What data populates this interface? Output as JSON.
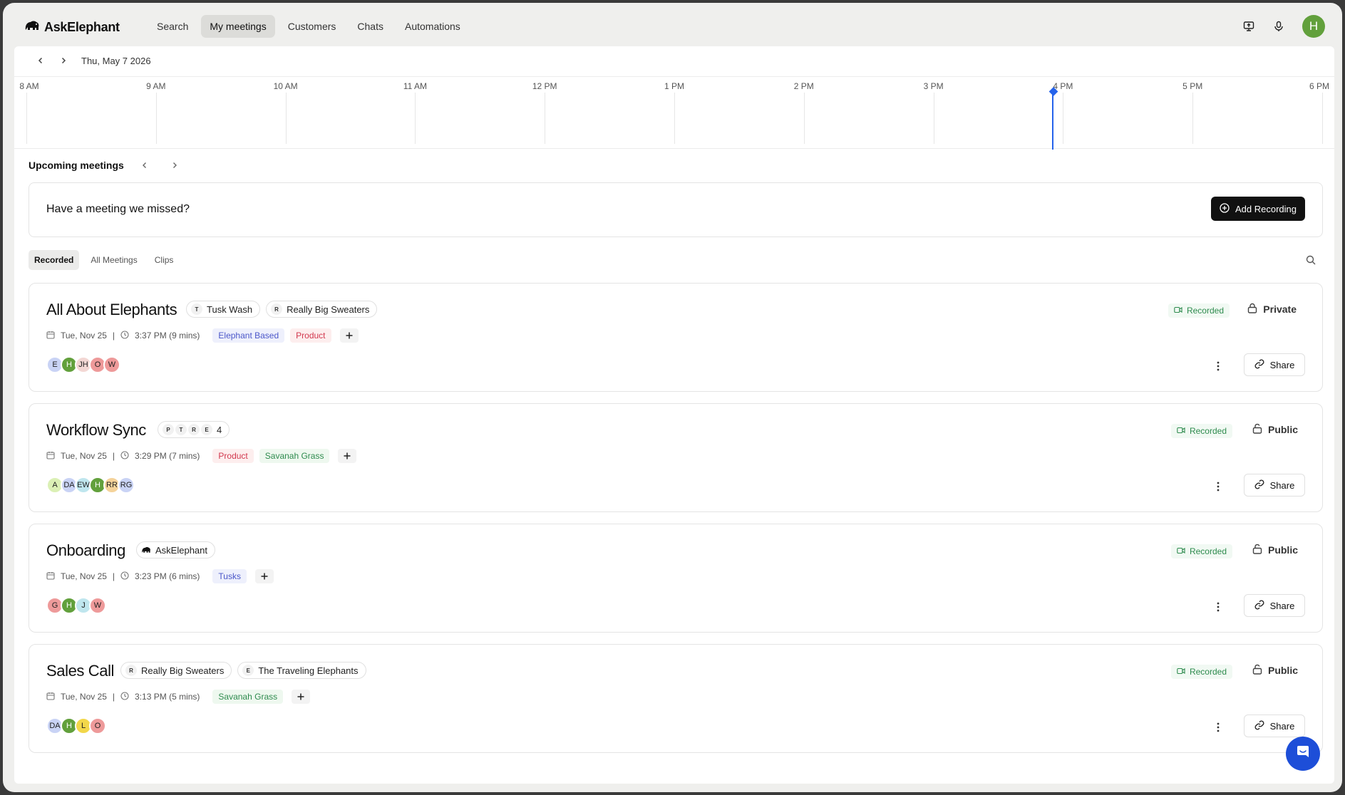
{
  "app": {
    "name": "AskElephant"
  },
  "nav": [
    {
      "label": "Search",
      "active": false
    },
    {
      "label": "My meetings",
      "active": true
    },
    {
      "label": "Customers",
      "active": false
    },
    {
      "label": "Chats",
      "active": false
    },
    {
      "label": "Automations",
      "active": false
    }
  ],
  "user": {
    "initial": "H"
  },
  "date": {
    "label": "Thu, May 7 2026"
  },
  "timeline": {
    "hours": [
      "8 AM",
      "9 AM",
      "10 AM",
      "11 AM",
      "12 PM",
      "1 PM",
      "2 PM",
      "3 PM",
      "4 PM",
      "5 PM",
      "6 PM"
    ],
    "now_fraction": 0.792
  },
  "upcoming": {
    "title": "Upcoming meetings"
  },
  "missed": {
    "text": "Have a meeting we missed?",
    "button": "Add Recording"
  },
  "tabs": [
    {
      "label": "Recorded",
      "active": true
    },
    {
      "label": "All Meetings",
      "active": false
    },
    {
      "label": "Clips",
      "active": false
    }
  ],
  "colors": {
    "accent": "#2563eb",
    "recorded": "#2e8b4e",
    "avatar_green": "#62a03c"
  },
  "meetings": [
    {
      "title": "All About Elephants",
      "companies": [
        {
          "badge": "T",
          "name": "Tusk Wash"
        },
        {
          "badge": "R",
          "name": "Really Big Sweaters"
        }
      ],
      "date": "Tue, Nov 25",
      "time": "3:37 PM (9 mins)",
      "tags": [
        {
          "label": "Elephant Based",
          "kind": "blue"
        },
        {
          "label": "Product",
          "kind": "red"
        }
      ],
      "participants": [
        {
          "initials": "E",
          "color": "#c9d3f5"
        },
        {
          "initials": "H",
          "color": "#62a03c"
        },
        {
          "initials": "JH",
          "color": "#f3d7d4"
        },
        {
          "initials": "O",
          "color": "#ee9a9a"
        },
        {
          "initials": "W",
          "color": "#ee9a9a"
        }
      ],
      "status": "Recorded",
      "privacy": "Private",
      "share": "Share"
    },
    {
      "title": "Workflow Sync",
      "company_badges": [
        "P",
        "T",
        "R",
        "E"
      ],
      "company_count": "4",
      "date": "Tue, Nov 25",
      "time": "3:29 PM (7 mins)",
      "tags": [
        {
          "label": "Product",
          "kind": "red"
        },
        {
          "label": "Savanah Grass",
          "kind": "green"
        }
      ],
      "participants": [
        {
          "initials": "A",
          "color": "#dbf0b5"
        },
        {
          "initials": "DA",
          "color": "#c9d3f5"
        },
        {
          "initials": "EW",
          "color": "#bfe6ee"
        },
        {
          "initials": "H",
          "color": "#62a03c"
        },
        {
          "initials": "RR",
          "color": "#f5d39a"
        },
        {
          "initials": "RG",
          "color": "#c9d3f5"
        }
      ],
      "status": "Recorded",
      "privacy": "Public",
      "share": "Share"
    },
    {
      "title": "Onboarding",
      "companies": [
        {
          "badge": "elephant",
          "name": "AskElephant"
        }
      ],
      "date": "Tue, Nov 25",
      "time": "3:23 PM (6 mins)",
      "tags": [
        {
          "label": "Tusks",
          "kind": "blue"
        }
      ],
      "participants": [
        {
          "initials": "G",
          "color": "#ee9a9a"
        },
        {
          "initials": "H",
          "color": "#62a03c"
        },
        {
          "initials": "J",
          "color": "#bfe6ee"
        },
        {
          "initials": "W",
          "color": "#ee9a9a"
        }
      ],
      "status": "Recorded",
      "privacy": "Public",
      "share": "Share"
    },
    {
      "title": "Sales Call",
      "companies": [
        {
          "badge": "R",
          "name": "Really Big Sweaters"
        },
        {
          "badge": "E",
          "name": "The Traveling Elephants"
        }
      ],
      "date": "Tue, Nov 25",
      "time": "3:13 PM (5 mins)",
      "tags": [
        {
          "label": "Savanah Grass",
          "kind": "green"
        }
      ],
      "participants": [
        {
          "initials": "DA",
          "color": "#c9d3f5"
        },
        {
          "initials": "H",
          "color": "#62a03c"
        },
        {
          "initials": "L",
          "color": "#f2d74a"
        },
        {
          "initials": "O",
          "color": "#ee9a9a"
        }
      ],
      "status": "Recorded",
      "privacy": "Public",
      "share": "Share"
    }
  ]
}
